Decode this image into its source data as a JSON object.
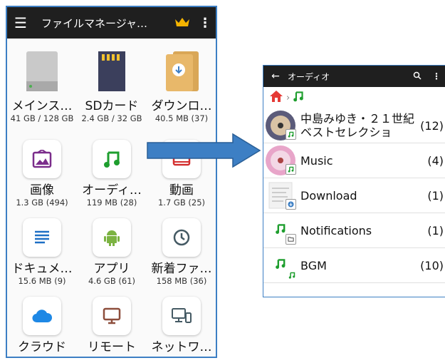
{
  "left": {
    "title": "ファイルマネージャ…",
    "items": [
      {
        "name": "メインス…",
        "size": "41 GB / 128 GB"
      },
      {
        "name": "SDカード",
        "size": "2.4 GB / 32 GB"
      },
      {
        "name": "ダウンロ…",
        "size": "40.5 MB (37)"
      },
      {
        "name": "画像",
        "size": "1.3 GB (494)"
      },
      {
        "name": "オーディ…",
        "size": "119 MB (28)"
      },
      {
        "name": "動画",
        "size": "1.7 GB (25)"
      },
      {
        "name": "ドキュメ…",
        "size": "15.6 MB (9)"
      },
      {
        "name": "アプリ",
        "size": "4.6 GB (61)"
      },
      {
        "name": "新着ファ…",
        "size": "158 MB (36)"
      },
      {
        "name": "クラウド",
        "size": ""
      },
      {
        "name": "リモート",
        "size": ""
      },
      {
        "name": "ネットワ…",
        "size": ""
      }
    ]
  },
  "right": {
    "title": "オーディオ",
    "rows": [
      {
        "label": "中島みゆき・２１世紀ベストセレクショ",
        "count": "(12)"
      },
      {
        "label": "Music",
        "count": "(4)"
      },
      {
        "label": "Download",
        "count": "(1)"
      },
      {
        "label": "Notifications",
        "count": "(1)"
      },
      {
        "label": "BGM",
        "count": "(10)"
      }
    ]
  },
  "colors": {
    "appbar": "#1f1f1f",
    "accent": "#1e9e2e",
    "folder": "#e8b86a",
    "crown": "#f5b400",
    "arrow": "#3d7fc4"
  }
}
